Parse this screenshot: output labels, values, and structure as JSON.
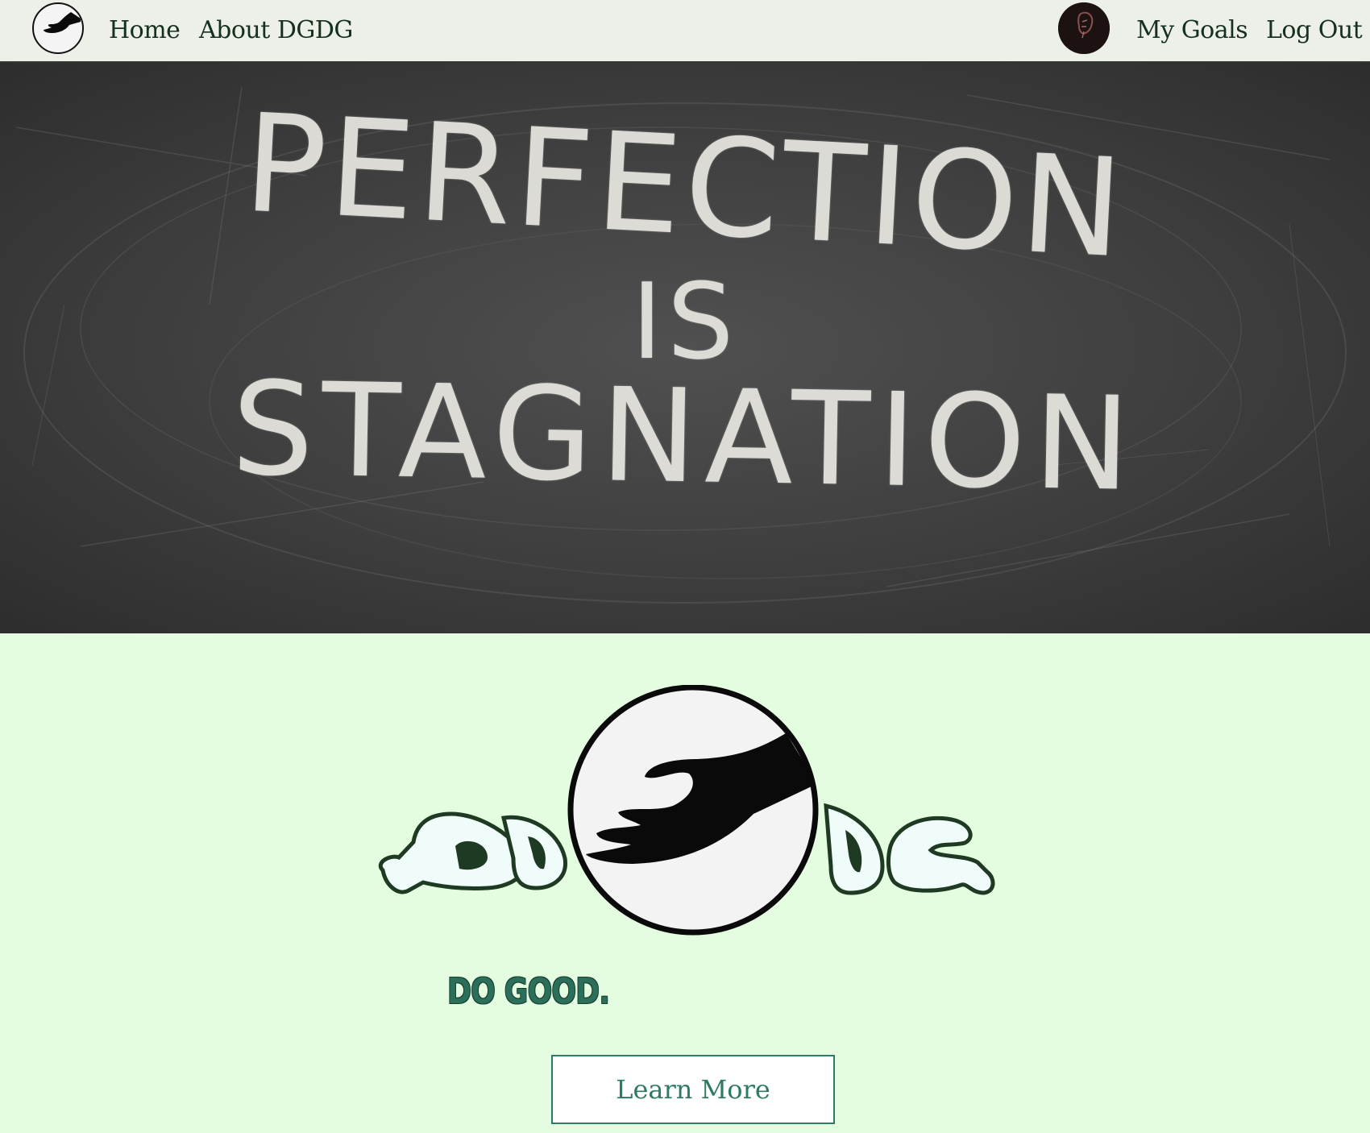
{
  "nav": {
    "home_label": "Home",
    "about_label": "About DGDG",
    "goals_label": "My Goals",
    "logout_label": "Log Out"
  },
  "hero": {
    "line1": "PERFECTION",
    "line2": "IS",
    "line3": "STAGNATION"
  },
  "brand": {
    "tagline": "DO GOOD.",
    "learn_more_label": "Learn More"
  },
  "colors": {
    "background": "#e4fce0",
    "navbar": "#ecf0e8",
    "accent": "#2d7a66",
    "chalkboard": "#404040"
  },
  "icons": {
    "nav_logo": "hand-logo-icon",
    "avatar": "user-avatar-icon"
  }
}
